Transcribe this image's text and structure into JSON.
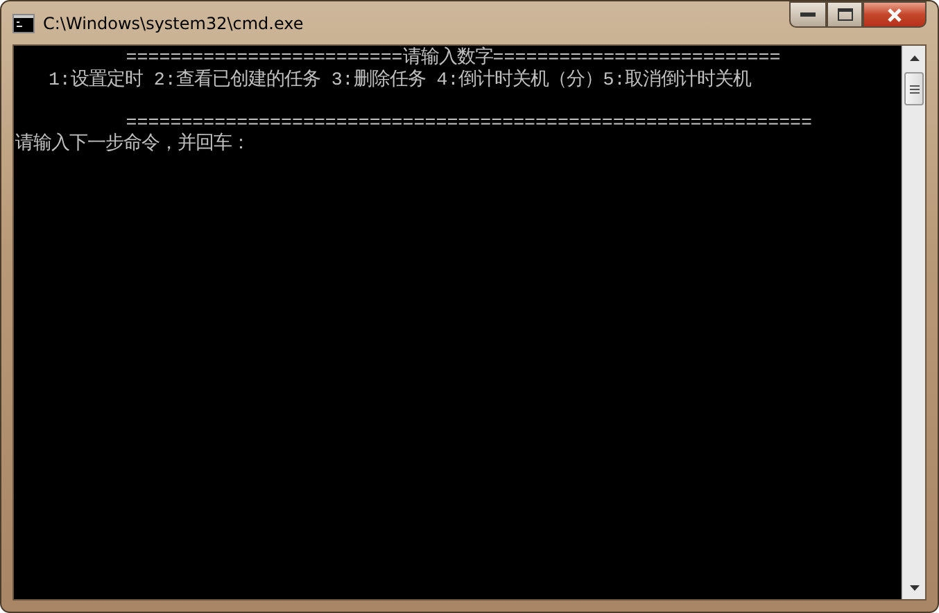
{
  "window": {
    "title": "C:\\Windows\\system32\\cmd.exe"
  },
  "console": {
    "lines": [
      {
        "kind": "text",
        "text": "          =========================请输入数字=========================="
      },
      {
        "kind": "text",
        "text": "   1:设置定时 2:查看已创建的任务 3:删除任务 4:倒计时关机（分）5:取消倒计时关机"
      },
      {
        "kind": "blank"
      },
      {
        "kind": "text",
        "text": "          =============================================================="
      },
      {
        "kind": "text",
        "text": "请输入下一步命令，并回车："
      }
    ]
  }
}
